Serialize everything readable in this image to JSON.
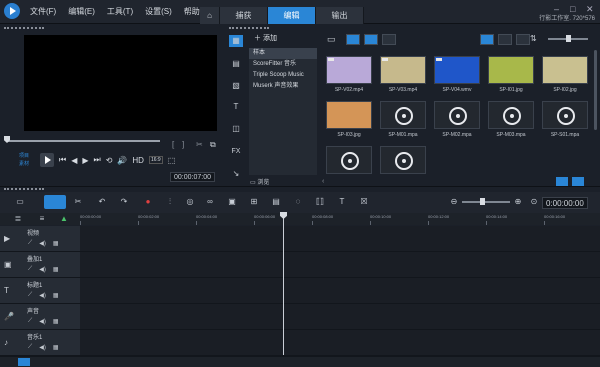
{
  "menu": [
    "文件(F)",
    "编辑(E)",
    "工具(T)",
    "设置(S)",
    "帮助(H)"
  ],
  "tabs": {
    "capture": "捕获",
    "edit": "编辑",
    "output": "输出"
  },
  "window": {
    "project": "行影工作室. 720*576"
  },
  "player": {
    "label_project": "项目",
    "label_clip": "素材",
    "hd": "HD",
    "speed": "16:9",
    "timecode": "00:00:07:00"
  },
  "library": {
    "add": "添加",
    "items": [
      "样本",
      "ScoreFitter 音乐",
      "Triple Scoop Music",
      "Muserk 声音效果"
    ],
    "browse": "浏览"
  },
  "media": [
    {
      "cap": "SP-V02.mp4",
      "kind": "video",
      "color": "#b9a9d8"
    },
    {
      "cap": "SP-V03.mp4",
      "kind": "video",
      "color": "#c6b98c"
    },
    {
      "cap": "SP-V04.wmv",
      "kind": "video",
      "color": "#1f56c9"
    },
    {
      "cap": "SP-I01.jpg",
      "kind": "photo",
      "color": "#a8b84a"
    },
    {
      "cap": "SP-I02.jpg",
      "kind": "photo",
      "color": "#c9c090"
    },
    {
      "cap": "SP-I03.jpg",
      "kind": "photo",
      "color": "#d49557"
    },
    {
      "cap": "SP-M01.mpa",
      "kind": "audio"
    },
    {
      "cap": "SP-M02.mpa",
      "kind": "audio"
    },
    {
      "cap": "SP-M03.mpa",
      "kind": "audio"
    },
    {
      "cap": "SP-S01.mpa",
      "kind": "audio"
    },
    {
      "cap": "",
      "kind": "audio"
    },
    {
      "cap": "",
      "kind": "audio"
    }
  ],
  "timeline": {
    "timecode": "0:00:00:00",
    "ruler": [
      "00:00:00:00",
      "00:00:02:00",
      "00:00:04:00",
      "00:00:06:00",
      "00:00:08:00",
      "00:00:10:00",
      "00:00:12:00",
      "00:00:14:00",
      "00:00:16:00"
    ],
    "tracks": [
      {
        "name": "视频",
        "icon": "▶"
      },
      {
        "name": "叠加1",
        "icon": "▣"
      },
      {
        "name": "标题1",
        "icon": "T"
      },
      {
        "name": "声音",
        "icon": "🎤"
      },
      {
        "name": "音乐1",
        "icon": "♪"
      }
    ]
  }
}
